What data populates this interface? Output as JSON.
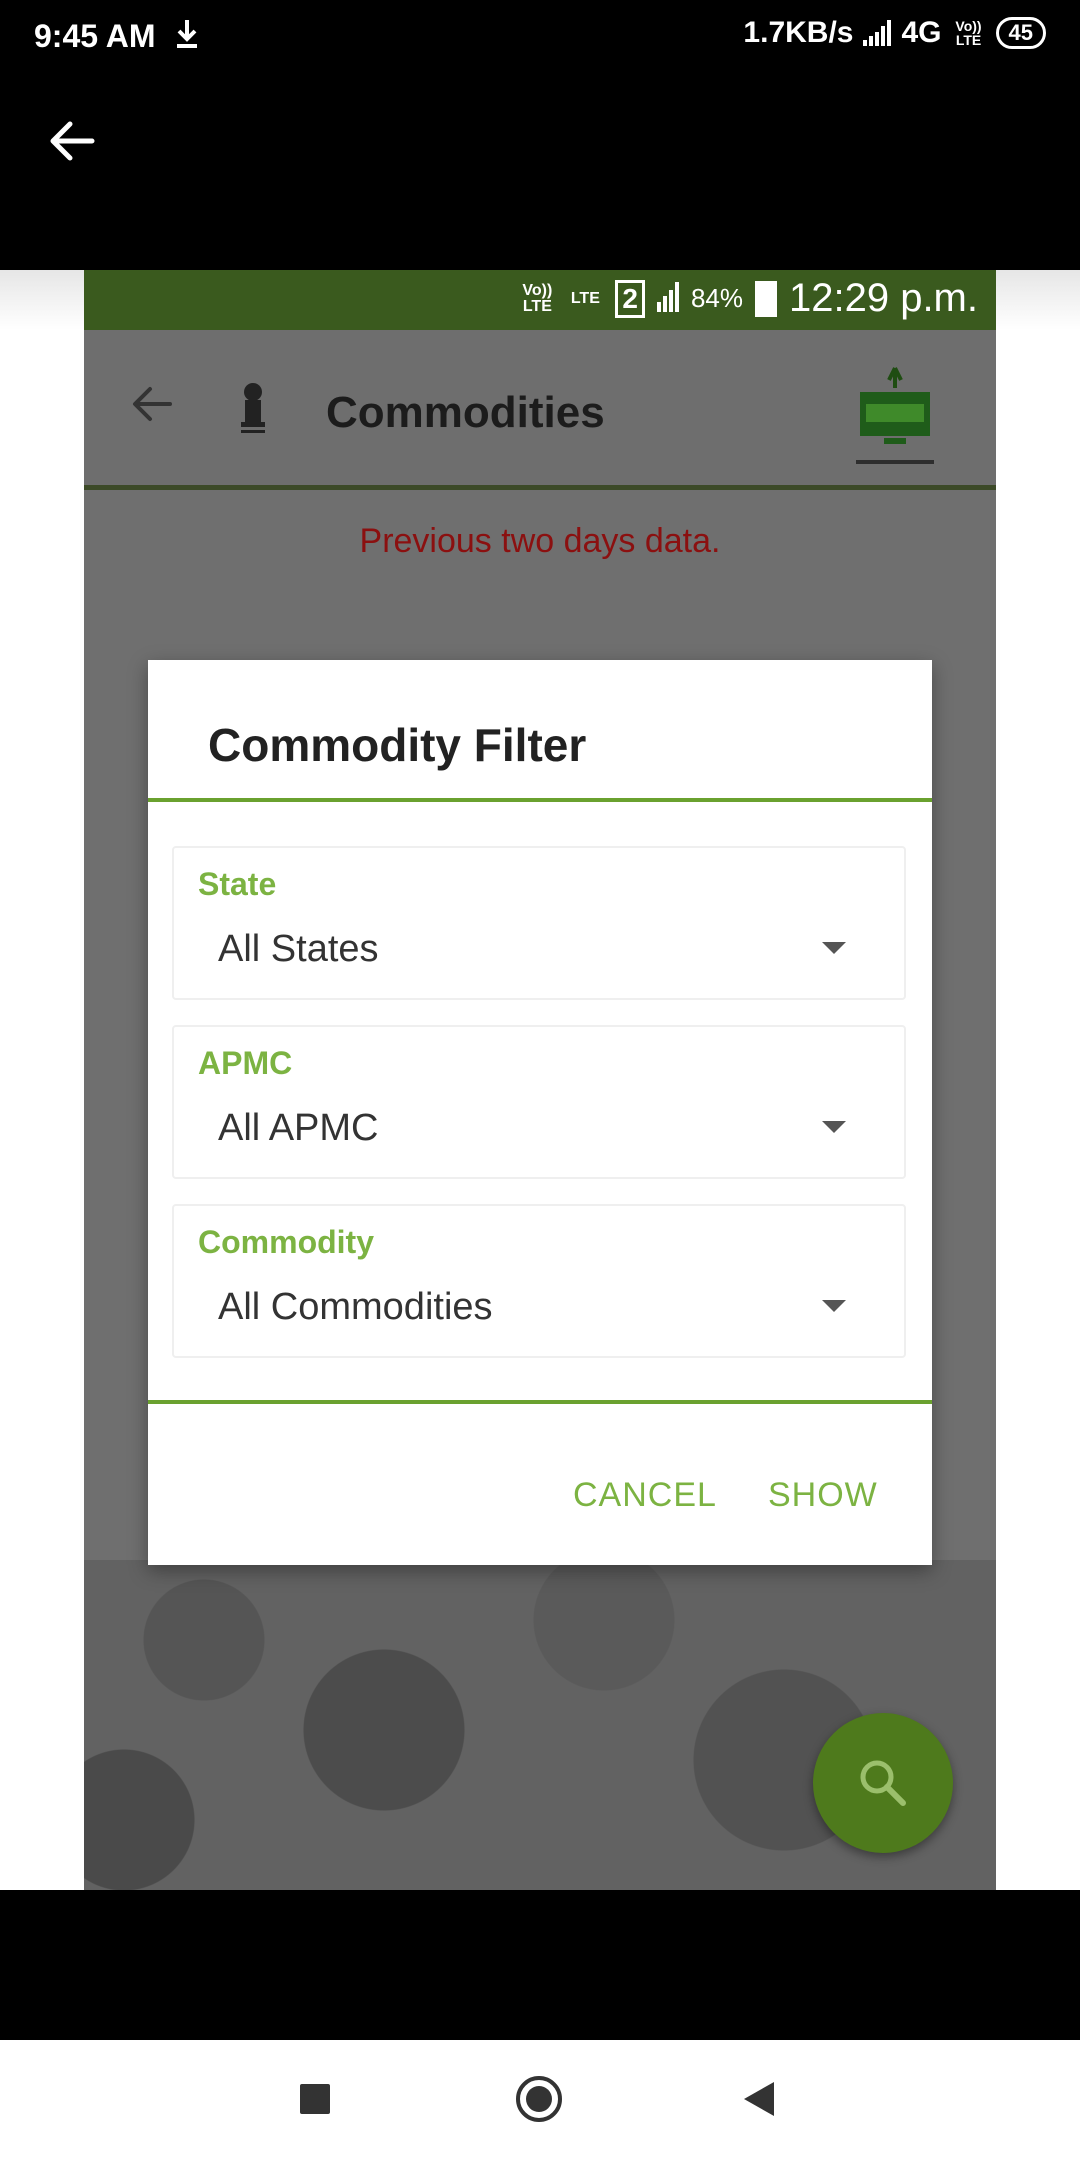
{
  "device_status": {
    "time": "9:45 AM",
    "net_speed": "1.7KB/s",
    "network": "4G",
    "volte": "Vo)) LTE",
    "battery": "45"
  },
  "inner_status": {
    "volte": "Vo)) LTE",
    "lte": "LTE",
    "sim": "2",
    "battery_pct": "84%",
    "time": "12:29 p.m."
  },
  "app": {
    "title": "Commodities",
    "notice": "Previous two days data."
  },
  "dialog": {
    "title": "Commodity Filter",
    "fields": [
      {
        "label": "State",
        "value": "All States"
      },
      {
        "label": "APMC",
        "value": "All APMC"
      },
      {
        "label": "Commodity",
        "value": "All Commodities"
      }
    ],
    "cancel_label": "CANCEL",
    "show_label": "SHOW"
  },
  "icons": {
    "outer_back": "arrow-left-icon",
    "download": "download-icon",
    "inner_back": "arrow-left-icon",
    "emblem": "emblem-icon",
    "logo": "enam-logo",
    "fab": "search-icon",
    "nav": [
      "recents-icon",
      "home-icon",
      "back-icon"
    ]
  },
  "colors": {
    "accent_green": "#7cb342",
    "inner_status_bg": "#3a5a1e",
    "fab_green": "#4e7a1c",
    "notice_red": "#8b1010"
  }
}
